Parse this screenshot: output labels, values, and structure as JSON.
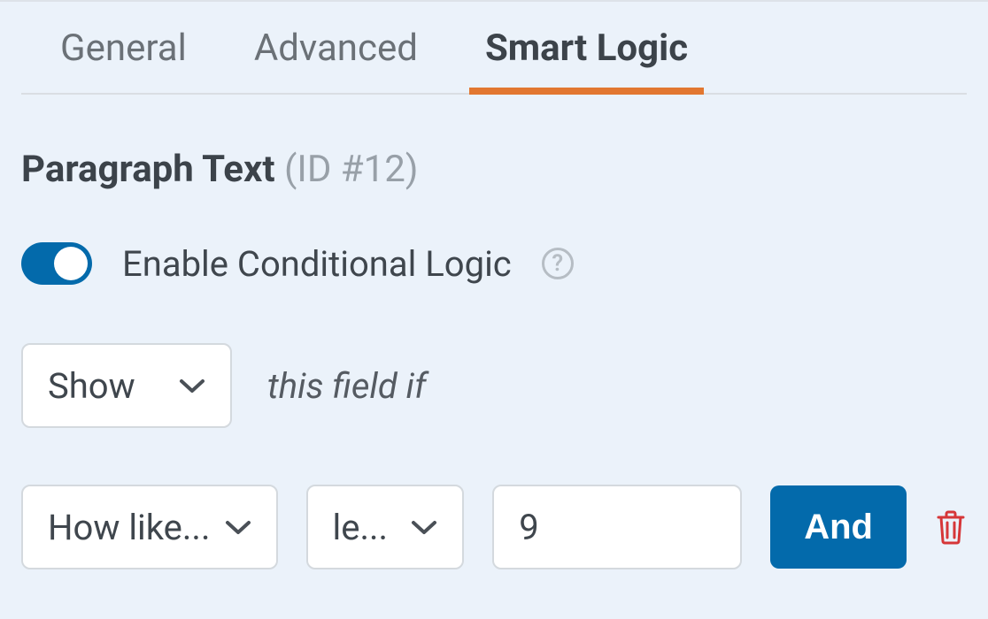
{
  "tabs": {
    "general": "General",
    "advanced": "Advanced",
    "smartlogic": "Smart Logic"
  },
  "heading": {
    "title": "Paragraph Text",
    "id_label": "(ID #12)"
  },
  "toggle": {
    "label": "Enable Conditional Logic",
    "state": "on"
  },
  "showhide": {
    "selected": "Show",
    "suffix": "this field if"
  },
  "rule": {
    "field": "How like...",
    "operator": "le...",
    "value": "9",
    "and_label": "And"
  }
}
